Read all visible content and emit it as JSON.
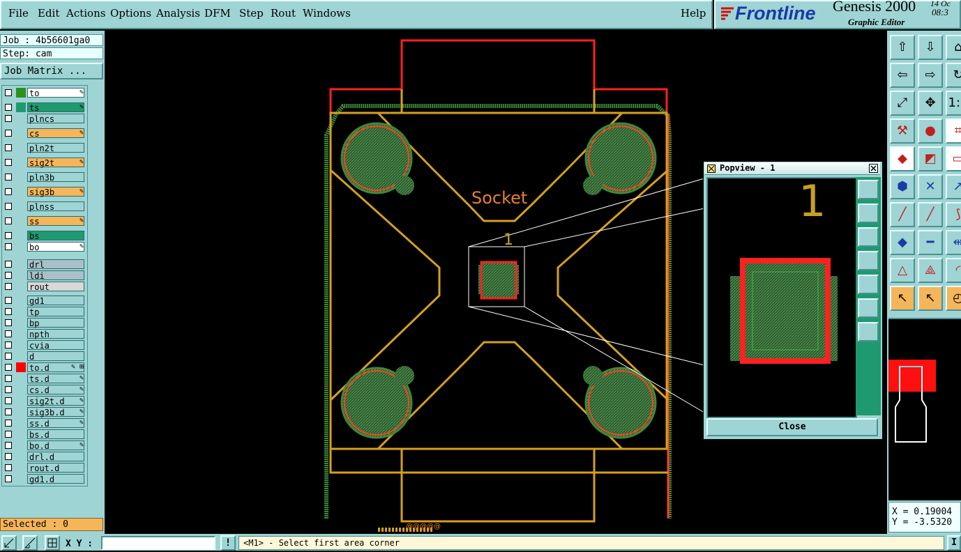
{
  "menu": {
    "items": [
      "File",
      "Edit",
      "Actions",
      "Options",
      "Analysis",
      "DFM",
      "Step",
      "Rout",
      "Windows"
    ],
    "help": "Help"
  },
  "brand": {
    "logo_text": "Frontline",
    "product": "Genesis 2000",
    "subtitle": "Graphic Editor",
    "date": "14 Oc",
    "time": "08:3"
  },
  "left": {
    "job": "Job : 4b56601ga0",
    "step": "Step: cam",
    "job_matrix_button": "Job Matrix ...",
    "selected": "Selected : 0"
  },
  "layers": [
    {
      "name": "to",
      "color": "#ffffff",
      "swatch": "#2f8f1f",
      "mark": "✎"
    },
    {
      "name": "ts",
      "color": "#1f9a70",
      "swatch": "#1f9a70",
      "mark": "✎"
    },
    {
      "name": "plncs",
      "color": "#9fd4d4",
      "swatch": "",
      "mark": ""
    },
    {
      "name": "cs",
      "color": "#f5b55a",
      "swatch": "",
      "mark": "✎"
    },
    {
      "name": "pln2t",
      "color": "#9fd4d4",
      "swatch": "",
      "mark": ""
    },
    {
      "name": "sig2t",
      "color": "#f5b55a",
      "swatch": "",
      "mark": "✎"
    },
    {
      "name": "pln3b",
      "color": "#9fd4d4",
      "swatch": "",
      "mark": ""
    },
    {
      "name": "sig3b",
      "color": "#f5b55a",
      "swatch": "",
      "mark": "✎"
    },
    {
      "name": "plnss",
      "color": "#9fd4d4",
      "swatch": "",
      "mark": ""
    },
    {
      "name": "ss",
      "color": "#f5b55a",
      "swatch": "",
      "mark": "✎"
    },
    {
      "name": "bs",
      "color": "#1f9a70",
      "swatch": "",
      "mark": ""
    },
    {
      "name": "bo",
      "color": "#ffffff",
      "swatch": "",
      "mark": "✎"
    },
    {
      "name": "drl",
      "color": "#a9c0c8",
      "swatch": "",
      "mark": ""
    },
    {
      "name": "ldi",
      "color": "#a9c0c8",
      "swatch": "",
      "mark": ""
    },
    {
      "name": "rout",
      "color": "#d8d8d8",
      "swatch": "",
      "mark": ""
    },
    {
      "name": "gd1",
      "color": "#9fd4d4",
      "swatch": "",
      "mark": ""
    },
    {
      "name": "tp",
      "color": "#9fd4d4",
      "swatch": "",
      "mark": ""
    },
    {
      "name": "bp",
      "color": "#9fd4d4",
      "swatch": "",
      "mark": ""
    },
    {
      "name": "npth",
      "color": "#9fd4d4",
      "swatch": "",
      "mark": ""
    },
    {
      "name": "cvia",
      "color": "#9fd4d4",
      "swatch": "",
      "mark": ""
    },
    {
      "name": "d",
      "color": "#9fd4d4",
      "swatch": "",
      "mark": ""
    },
    {
      "name": "to.d",
      "color": "#9fd4d4",
      "swatch": "#ff0000",
      "mark": "✎ ⊞"
    },
    {
      "name": "ts.d",
      "color": "#9fd4d4",
      "swatch": "",
      "mark": "✎"
    },
    {
      "name": "cs.d",
      "color": "#9fd4d4",
      "swatch": "",
      "mark": "✎"
    },
    {
      "name": "sig2t.d",
      "color": "#9fd4d4",
      "swatch": "",
      "mark": "✎"
    },
    {
      "name": "sig3b.d",
      "color": "#9fd4d4",
      "swatch": "",
      "mark": "✎"
    },
    {
      "name": "ss.d",
      "color": "#9fd4d4",
      "swatch": "",
      "mark": "✎"
    },
    {
      "name": "bs.d",
      "color": "#9fd4d4",
      "swatch": "",
      "mark": ""
    },
    {
      "name": "bo.d",
      "color": "#9fd4d4",
      "swatch": "",
      "mark": "✎"
    },
    {
      "name": "drl.d",
      "color": "#9fd4d4",
      "swatch": "",
      "mark": ""
    },
    {
      "name": "rout.d",
      "color": "#9fd4d4",
      "swatch": "",
      "mark": ""
    },
    {
      "name": "gd1.d",
      "color": "#9fd4d4",
      "swatch": "",
      "mark": ""
    }
  ],
  "canvas": {
    "silk_text": "Socket",
    "pin_label": "1",
    "bottom_text": "@@@@@"
  },
  "popview": {
    "title": "Popview - 1",
    "pin_label": "1",
    "close_button": "Close"
  },
  "coords": {
    "x": "X = 0.19004",
    "y": "Y = -3.5320"
  },
  "status": {
    "xy_label": "X Y :",
    "xy_value": "",
    "warn": "!",
    "message": "<M1> - Select first area corner",
    "right_edge": "I"
  },
  "colors": {
    "panel": "#9fd4d4",
    "copper": "#d4a020",
    "red": "#ff2020",
    "green": "#3c7a3c"
  }
}
